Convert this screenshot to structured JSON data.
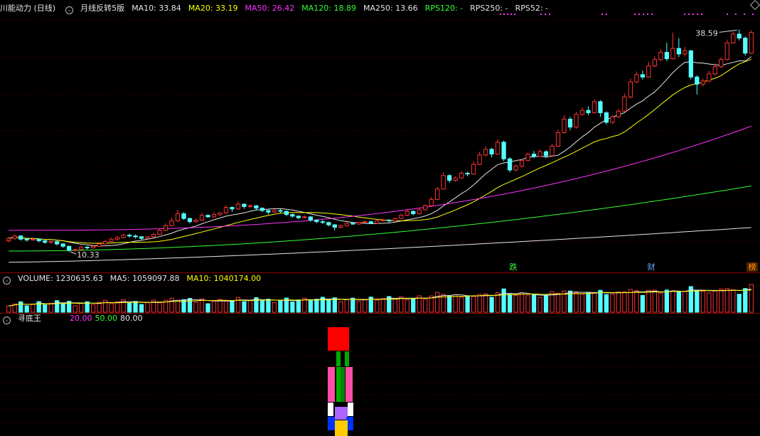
{
  "main_panel": {
    "stock_name": "川能动力 (日线)",
    "indicator": "月线反转5版",
    "ma": [
      {
        "label": "MA10: 33.84",
        "color": "#e6e6e6"
      },
      {
        "label": "MA20: 33.19",
        "color": "#ffff00"
      },
      {
        "label": "MA50: 26.42",
        "color": "#ff33ff"
      },
      {
        "label": "MA120: 18.89",
        "color": "#33ff33"
      },
      {
        "label": "MA250: 13.66",
        "color": "#e6e6e6"
      },
      {
        "label": "RPS120: -",
        "color": "#33ff33"
      },
      {
        "label": "RPS250: -",
        "color": "#e6e6e6"
      },
      {
        "label": "RPS52: -",
        "color": "#e6e6e6"
      }
    ],
    "high_label": "38.59",
    "low_label": "10.33",
    "events": [
      {
        "text": "跌",
        "color": "#33ff33"
      },
      {
        "text": "财",
        "color": "#66aaff"
      },
      {
        "text": "榜",
        "color": "#ff9900"
      }
    ]
  },
  "volume_panel": {
    "title": "VOLUME: 1230635.63",
    "ma5": "MA5: 1059097.88",
    "ma10": "MA10: 1040174.00"
  },
  "xundi_panel": {
    "title": "寻底王",
    "levels": [
      {
        "label": "20.00",
        "color": "#ff33ff"
      },
      {
        "label": "50.00",
        "color": "#33ff33"
      },
      {
        "label": "80.00",
        "color": "#e6e6e6"
      }
    ]
  },
  "chart_data": {
    "type": "candlestick",
    "title": "川能动力 (日线)",
    "price_range": [
      9.0,
      40.5
    ],
    "high": 38.59,
    "low": 10.33,
    "ma_latest": {
      "MA10": 33.84,
      "MA20": 33.19,
      "MA50": 26.42,
      "MA120": 18.89,
      "MA250": 13.66
    },
    "volume_latest": {
      "VOLUME": 1230635.63,
      "MA5": 1059097.88,
      "MA10": 1040174.0
    },
    "colors": {
      "up": "#ff3232",
      "down": "#54ffff",
      "ma10": "#e6e6e6",
      "ma20": "#ffff00",
      "ma50": "#ff33ff",
      "ma120": "#33ff33",
      "ma250": "#e6e6e6"
    },
    "candles": [
      [
        12.0,
        12.3,
        12.5,
        11.8
      ],
      [
        12.3,
        12.6,
        12.8,
        12.1
      ],
      [
        12.6,
        12.2,
        12.7,
        12.0
      ],
      [
        12.2,
        12.1,
        12.4,
        11.9
      ],
      [
        12.1,
        12.2,
        12.3,
        12.0
      ],
      [
        12.2,
        12.0,
        12.3,
        11.8
      ],
      [
        12.0,
        11.8,
        12.1,
        11.6
      ],
      [
        11.8,
        11.9,
        12.0,
        11.6
      ],
      [
        11.9,
        11.6,
        12.0,
        11.4
      ],
      [
        11.6,
        11.3,
        11.7,
        11.1
      ],
      [
        11.3,
        10.8,
        11.4,
        10.6
      ],
      [
        10.8,
        10.9,
        11.0,
        10.6
      ],
      [
        10.9,
        11.2,
        11.3,
        10.7
      ],
      [
        11.2,
        11.1,
        11.3,
        10.9
      ],
      [
        11.1,
        11.3,
        11.5,
        11.0
      ],
      [
        11.3,
        11.6,
        11.8,
        11.2
      ],
      [
        11.6,
        11.9,
        12.1,
        11.5
      ],
      [
        11.9,
        12.2,
        12.4,
        11.8
      ],
      [
        12.2,
        12.4,
        12.6,
        12.0
      ],
      [
        12.4,
        12.7,
        12.9,
        12.3
      ],
      [
        12.7,
        12.6,
        12.9,
        12.4
      ],
      [
        12.6,
        12.5,
        12.8,
        12.3
      ],
      [
        12.5,
        12.3,
        12.6,
        12.1
      ],
      [
        12.3,
        12.5,
        12.6,
        12.2
      ],
      [
        12.5,
        12.8,
        13.0,
        12.4
      ],
      [
        12.8,
        13.3,
        13.5,
        12.7
      ],
      [
        13.3,
        13.9,
        14.2,
        13.2
      ],
      [
        13.9,
        14.5,
        14.9,
        13.8
      ],
      [
        14.5,
        15.4,
        15.9,
        14.4
      ],
      [
        15.4,
        14.8,
        15.6,
        14.6
      ],
      [
        14.8,
        14.4,
        14.9,
        14.2
      ],
      [
        14.4,
        14.6,
        14.8,
        14.3
      ],
      [
        14.6,
        15.2,
        15.5,
        14.5
      ],
      [
        15.2,
        15.0,
        15.3,
        14.9
      ],
      [
        15.0,
        15.3,
        15.6,
        14.9
      ],
      [
        15.3,
        15.5,
        15.6,
        15.1
      ],
      [
        15.5,
        16.2,
        16.5,
        15.4
      ],
      [
        16.2,
        16.0,
        16.3,
        15.6
      ],
      [
        16.0,
        16.6,
        16.9,
        15.9
      ],
      [
        16.6,
        16.3,
        16.7,
        16.0
      ],
      [
        16.3,
        16.4,
        16.6,
        16.1
      ],
      [
        16.4,
        16.1,
        16.5,
        15.8
      ],
      [
        16.1,
        15.8,
        16.2,
        15.6
      ],
      [
        15.8,
        15.6,
        15.9,
        15.3
      ],
      [
        15.6,
        15.8,
        16.0,
        15.5
      ],
      [
        15.8,
        15.7,
        16.0,
        15.5
      ],
      [
        15.7,
        15.3,
        15.8,
        15.1
      ],
      [
        15.3,
        15.1,
        15.4,
        14.9
      ],
      [
        15.1,
        14.9,
        15.2,
        14.7
      ],
      [
        14.9,
        15.0,
        15.2,
        14.8
      ],
      [
        15.0,
        14.6,
        15.1,
        14.4
      ],
      [
        14.6,
        14.4,
        14.7,
        14.2
      ],
      [
        14.4,
        14.3,
        14.6,
        14.1
      ],
      [
        14.3,
        14.0,
        14.4,
        13.8
      ],
      [
        14.0,
        13.7,
        14.1,
        13.3
      ],
      [
        13.7,
        13.9,
        14.0,
        13.6
      ],
      [
        13.9,
        14.2,
        14.3,
        13.8
      ],
      [
        14.2,
        14.1,
        14.3,
        14.0
      ],
      [
        14.1,
        14.3,
        14.4,
        14.0
      ],
      [
        14.3,
        14.4,
        14.5,
        14.2
      ],
      [
        14.4,
        14.2,
        14.5,
        14.1
      ],
      [
        14.2,
        14.5,
        14.6,
        14.1
      ],
      [
        14.5,
        14.6,
        14.8,
        14.4
      ],
      [
        14.6,
        14.5,
        14.7,
        14.3
      ],
      [
        14.5,
        14.8,
        14.9,
        14.4
      ],
      [
        14.8,
        15.2,
        15.4,
        14.7
      ],
      [
        15.2,
        15.7,
        15.9,
        15.1
      ],
      [
        15.7,
        15.4,
        15.8,
        15.2
      ],
      [
        15.4,
        15.9,
        16.1,
        15.3
      ],
      [
        15.9,
        16.4,
        16.6,
        15.8
      ],
      [
        16.4,
        17.2,
        17.5,
        16.3
      ],
      [
        17.2,
        18.5,
        18.8,
        17.1
      ],
      [
        18.5,
        20.2,
        20.6,
        18.4
      ],
      [
        20.2,
        19.6,
        20.4,
        19.3
      ],
      [
        19.6,
        19.9,
        20.1,
        19.4
      ],
      [
        19.9,
        20.5,
        20.8,
        19.8
      ],
      [
        20.5,
        20.4,
        20.7,
        20.1
      ],
      [
        20.4,
        21.6,
        22.0,
        20.3
      ],
      [
        21.6,
        22.8,
        23.2,
        21.5
      ],
      [
        22.8,
        23.5,
        23.9,
        22.6
      ],
      [
        23.5,
        22.9,
        23.7,
        22.5
      ],
      [
        22.9,
        24.4,
        24.8,
        22.8
      ],
      [
        24.4,
        22.3,
        24.6,
        22.0
      ],
      [
        22.3,
        20.9,
        22.5,
        20.6
      ],
      [
        20.9,
        21.4,
        21.6,
        20.7
      ],
      [
        21.4,
        22.1,
        22.3,
        21.2
      ],
      [
        22.1,
        22.9,
        23.1,
        22.0
      ],
      [
        22.9,
        22.6,
        23.3,
        22.4
      ],
      [
        22.6,
        23.2,
        23.5,
        22.5
      ],
      [
        23.2,
        22.7,
        23.4,
        22.4
      ],
      [
        22.7,
        23.9,
        24.2,
        22.6
      ],
      [
        23.9,
        25.6,
        26.0,
        23.8
      ],
      [
        25.6,
        27.3,
        27.8,
        25.5
      ],
      [
        27.3,
        26.3,
        27.6,
        25.9
      ],
      [
        26.3,
        27.9,
        28.2,
        26.1
      ],
      [
        27.9,
        28.4,
        28.8,
        27.7
      ],
      [
        28.4,
        28.1,
        28.9,
        27.8
      ],
      [
        28.1,
        29.5,
        29.8,
        28.0
      ],
      [
        29.5,
        28.1,
        29.7,
        27.6
      ],
      [
        28.1,
        26.9,
        28.3,
        26.6
      ],
      [
        26.9,
        27.6,
        27.8,
        26.7
      ],
      [
        27.6,
        28.3,
        28.6,
        27.4
      ],
      [
        28.3,
        30.1,
        30.5,
        28.2
      ],
      [
        30.1,
        32.0,
        32.4,
        29.9
      ],
      [
        32.0,
        32.9,
        33.3,
        31.8
      ],
      [
        32.9,
        32.6,
        33.4,
        32.3
      ],
      [
        32.6,
        34.0,
        34.5,
        32.5
      ],
      [
        34.0,
        34.8,
        35.2,
        33.8
      ],
      [
        34.8,
        35.7,
        36.1,
        34.6
      ],
      [
        35.7,
        34.9,
        36.9,
        34.6
      ],
      [
        34.9,
        36.2,
        38.2,
        34.8
      ],
      [
        36.2,
        35.5,
        37.5,
        35.1
      ],
      [
        35.5,
        35.9,
        36.4,
        35.2
      ],
      [
        35.9,
        32.6,
        36.0,
        32.3
      ],
      [
        32.6,
        31.7,
        32.8,
        30.4
      ],
      [
        31.7,
        32.1,
        32.4,
        31.4
      ],
      [
        32.1,
        33.0,
        33.4,
        31.9
      ],
      [
        33.0,
        33.9,
        34.3,
        32.8
      ],
      [
        33.9,
        34.8,
        35.1,
        33.7
      ],
      [
        34.8,
        36.9,
        37.3,
        34.7
      ],
      [
        36.9,
        38.0,
        38.3,
        36.8
      ],
      [
        38.0,
        37.5,
        38.59,
        37.2
      ],
      [
        37.5,
        35.6,
        37.7,
        35.3
      ],
      [
        35.6,
        38.2,
        38.5,
        35.5
      ]
    ]
  }
}
